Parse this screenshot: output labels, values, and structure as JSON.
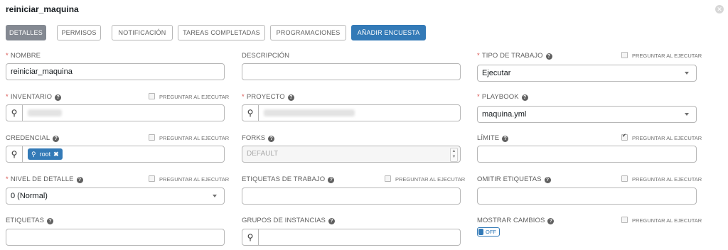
{
  "header": {
    "title": "reiniciar_maquina"
  },
  "tabs": [
    {
      "label": "DETALLES"
    },
    {
      "label": "PERMISOS"
    },
    {
      "label": "NOTIFICACIÓN"
    },
    {
      "label": "TAREAS COMPLETADAS"
    },
    {
      "label": "PROGRAMACIONES"
    },
    {
      "label": "AÑADIR ENCUESTA"
    }
  ],
  "prompt_label": "PREGUNTAR AL EJECUTAR",
  "help_glyph": "?",
  "required_marker": "*",
  "fields": {
    "nombre": {
      "label": "NOMBRE",
      "value": "reiniciar_maquina"
    },
    "descripcion": {
      "label": "DESCRIPCIÓN",
      "value": ""
    },
    "tipo_trabajo": {
      "label": "TIPO DE TRABAJO",
      "value": "Ejecutar",
      "prompt_checked": false
    },
    "inventario": {
      "label": "INVENTARIO",
      "prompt_checked": false
    },
    "proyecto": {
      "label": "PROYECTO"
    },
    "playbook": {
      "label": "PLAYBOOK",
      "value": "maquina.yml"
    },
    "credencial": {
      "label": "CREDENCIAL",
      "chip": "root",
      "prompt_checked": false
    },
    "forks": {
      "label": "FORKS",
      "placeholder": "DEFAULT"
    },
    "limite": {
      "label": "LÍMITE",
      "value": "",
      "prompt_checked": true
    },
    "nivel_detalle": {
      "label": "NIVEL DE DETALLE",
      "value": "0 (Normal)",
      "prompt_checked": false
    },
    "etiquetas_trabajo": {
      "label": "ETIQUETAS DE TRABAJO",
      "value": "",
      "prompt_checked": false
    },
    "omitir_etiquetas": {
      "label": "OMITIR ETIQUETAS",
      "value": "",
      "prompt_checked": false
    },
    "etiquetas": {
      "label": "ETIQUETAS",
      "value": ""
    },
    "grupos_instancias": {
      "label": "GRUPOS DE INSTANCIAS"
    },
    "mostrar_cambios": {
      "label": "MOSTRAR CAMBIOS",
      "toggle": "OFF",
      "prompt_checked": false
    }
  },
  "icons": {
    "search": "search-icon",
    "close": "close-icon",
    "key": "key-icon",
    "help": "help-icon"
  },
  "colors": {
    "primary": "#337ab7",
    "active_tab": "#848992",
    "required": "#d9534f"
  }
}
